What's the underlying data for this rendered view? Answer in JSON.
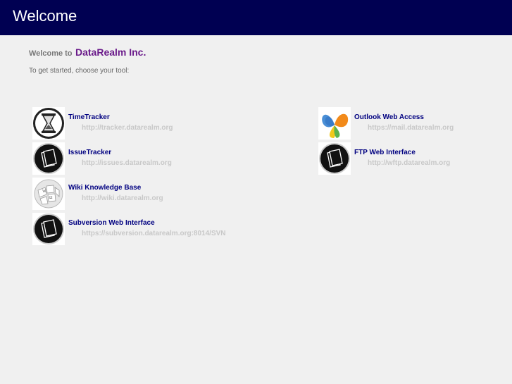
{
  "header": {
    "title": "Welcome"
  },
  "intro": {
    "welcome_prefix": "Welcome to",
    "company": "DataRealm Inc.",
    "instructions": "To get started, choose your tool:"
  },
  "tools": [
    {
      "name": "TimeTracker",
      "url": "http://tracker.datarealm.org",
      "icon": "hourglass-icon"
    },
    {
      "name": "IssueTracker",
      "url": "http://issues.datarealm.org",
      "icon": "folder-icon"
    },
    {
      "name": "Wiki Knowledge Base",
      "url": "http://wiki.datarealm.org",
      "icon": "wikipedia-globe-icon"
    },
    {
      "name": "Subversion Web Interface",
      "url": "https://subversion.datarealm.org:8014/SVN",
      "icon": "folder-icon"
    },
    {
      "name": "Outlook Web Access",
      "url": "https://mail.datarealm.org",
      "icon": "butterfly-icon"
    },
    {
      "name": "FTP Web Interface",
      "url": "http://wftp.datarealm.org",
      "icon": "folder-icon"
    }
  ],
  "colors": {
    "header_bg": "#000052",
    "brand": "#6a1a8a",
    "link": "#000080",
    "url": "#c8c8c8"
  }
}
